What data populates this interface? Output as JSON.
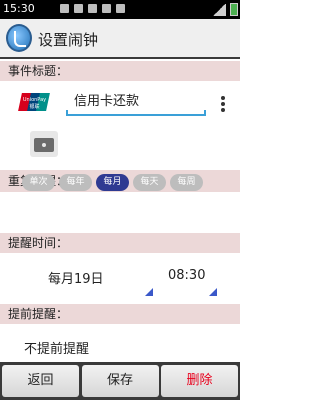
{
  "status_bar": {
    "time": "15:30"
  },
  "title_bar": {
    "title": "设置闹钟"
  },
  "sections": {
    "event_title": "事件标题：",
    "repeat": "重复提醒：",
    "remind_time": "提醒时间：",
    "advance": "提前提醒："
  },
  "event": {
    "bank_logo_text": "UnionPay 银联",
    "title_value": "信用卡还款"
  },
  "repeat_options": [
    {
      "label": "单次",
      "selected": false
    },
    {
      "label": "每年",
      "selected": false
    },
    {
      "label": "每月",
      "selected": true
    },
    {
      "label": "每天",
      "selected": false
    },
    {
      "label": "每周",
      "selected": false
    }
  ],
  "remind_time": {
    "date": "每月19日",
    "time": "08:30"
  },
  "advance": {
    "value": "不提前提醒"
  },
  "bottom_bar": {
    "back": "返回",
    "save": "保存",
    "delete": "删除"
  },
  "colors": {
    "section_bg": "#ecd8d8",
    "accent_blue": "#3aa0d8",
    "selected_pill": "#2f3a92",
    "pill": "#bdbdbd",
    "delete_red": "#e8001c"
  },
  "icons": {
    "app_logo": "app-logo-icon",
    "camera": "camera-icon",
    "overflow": "overflow-menu-icon",
    "spinner": "spinner-corner-icon"
  }
}
